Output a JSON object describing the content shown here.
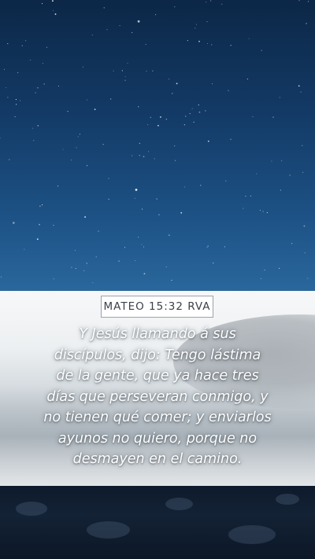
{
  "reference": "MATEO 15:32 RVA",
  "verse_lines": [
    "Y Jesús llamando á sus",
    "discípulos, dijo: Tengo lástima",
    "de la gente, que ya hace tres",
    "días que perseveran conmigo, y",
    "no tienen qué comer; y enviarlos",
    "ayunos no quiero, porque no",
    "desmayen en el camino."
  ]
}
